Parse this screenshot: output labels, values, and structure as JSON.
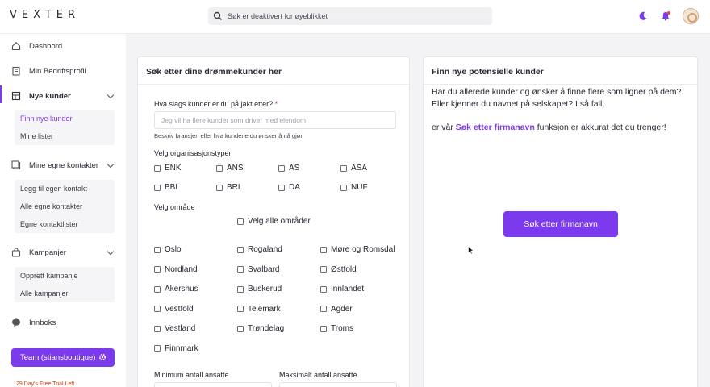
{
  "header": {
    "logo": "VEXTER",
    "search_text": "Søk er deaktivert for øyeblikket"
  },
  "sidebar": {
    "items": [
      {
        "label": "Dashbord",
        "icon": "home-icon"
      },
      {
        "label": "Min Bedriftsprofil",
        "icon": "building-icon"
      },
      {
        "label": "Nye kunder",
        "icon": "table-icon"
      },
      {
        "label": "Mine egne kontakter",
        "icon": "contacts-icon"
      },
      {
        "label": "Kampanjer",
        "icon": "shopping-bag-icon"
      },
      {
        "label": "Innboks",
        "icon": "chat-icon"
      }
    ],
    "nye_kunder_sub": [
      "Finn nye kunder",
      "Mine lister"
    ],
    "kontakter_sub": [
      "Legg til egen kontakt",
      "Alle egne kontakter",
      "Egne kontaktlister"
    ],
    "kampanjer_sub": [
      "Opprett kampanje",
      "Alle kampanjer"
    ],
    "team_button": "Team (stiansboutique)",
    "trial": "29 Day's Free Trial Left"
  },
  "left_panel": {
    "title": "Søk etter dine drømmekunder her",
    "question": "Hva slags kunder er du på jakt etter?",
    "required_mark": "*",
    "input_placeholder": "Jeg vil ha flere kunder som driver med eiendom",
    "input_help": "Beskriv bransjen eller hva kundene du ønsker å nå gjør.",
    "org_label": "Velg organisasjonstyper",
    "org_types": [
      "ENK",
      "ANS",
      "AS",
      "ASA",
      "BBL",
      "BRL",
      "DA",
      "NUF"
    ],
    "area_label": "Velg område",
    "select_all": "Velg alle områder",
    "areas": [
      "Oslo",
      "Rogaland",
      "Møre og Romsdal",
      "Nordland",
      "Svalbard",
      "Østfold",
      "Akershus",
      "Buskerud",
      "Innlandet",
      "Vestfold",
      "Telemark",
      "Agder",
      "Vestland",
      "Trøndelag",
      "Troms",
      "Finnmark"
    ],
    "min_label": "Minimum antall ansatte",
    "max_label": "Maksimalt antall ansatte"
  },
  "right_panel": {
    "title": "Finn nye potensielle kunder",
    "line1": "Har du allerede kunder og ønsker å finne flere som ligner på dem?",
    "line2": "Eller kjenner du navnet på selskapet? I så fall,",
    "line3_pre": "er vår",
    "line3_link": "Søk etter firmanavn",
    "line3_post": "funksjon er akkurat det du trenger!",
    "cta": "Søk etter firmanavn"
  },
  "colors": {
    "accent": "#7c3aed",
    "trial": "#c2410c"
  }
}
